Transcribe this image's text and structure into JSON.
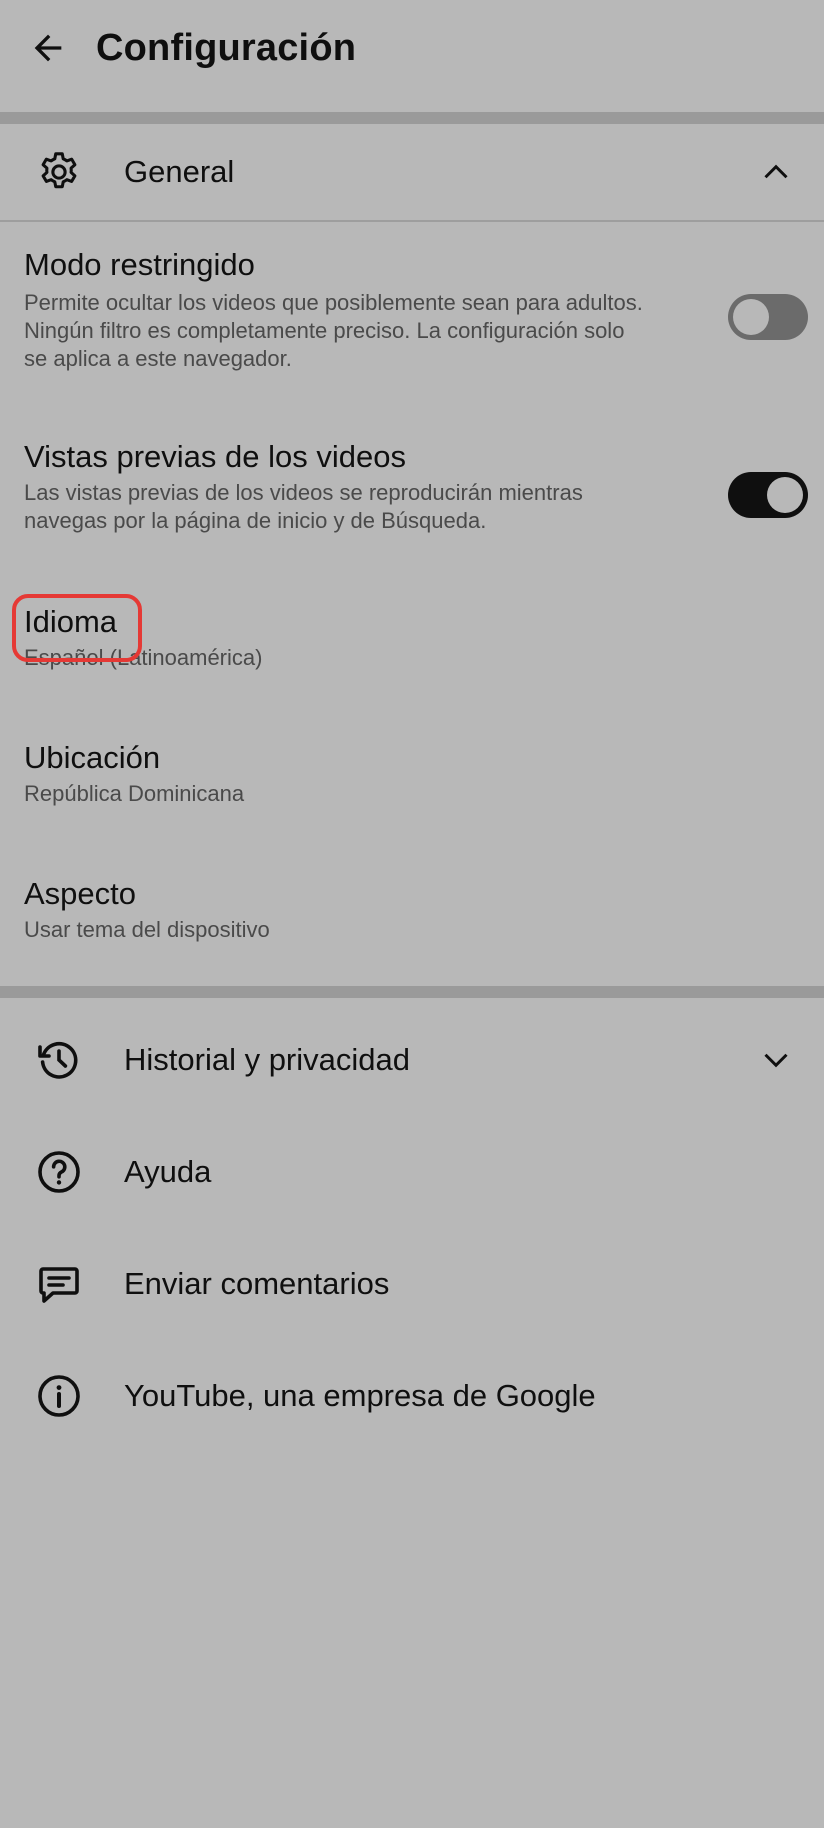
{
  "header": {
    "back_icon": "arrow-back-icon",
    "title": "Configuración"
  },
  "general": {
    "icon": "gear-icon",
    "label": "General",
    "expanded": true,
    "chevron_icon": "chevron-up-icon",
    "items": [
      {
        "title": "Modo restringido",
        "description": "Permite ocultar los videos que posiblemente sean para adultos. Ningún filtro es completamente preciso. La configuración solo se aplica a este navegador.",
        "toggle": "off"
      },
      {
        "title": "Vistas previas de los videos",
        "description": "Las vistas previas de los videos se reproducirán mientras navegas por la página de inicio y de Búsqueda.",
        "toggle": "on"
      },
      {
        "title": "Idioma",
        "value": "Español (Latinoamérica)",
        "highlighted": true
      },
      {
        "title": "Ubicación",
        "value": "República Dominicana"
      },
      {
        "title": "Aspecto",
        "value": "Usar tema del dispositivo"
      }
    ]
  },
  "menu": [
    {
      "icon": "history-icon",
      "label": "Historial y privacidad",
      "chevron_icon": "chevron-down-icon"
    },
    {
      "icon": "help-icon",
      "label": "Ayuda"
    },
    {
      "icon": "feedback-icon",
      "label": "Enviar comentarios"
    },
    {
      "icon": "info-icon",
      "label": "YouTube, una empresa de Google"
    }
  ],
  "colors": {
    "background": "#b8b8b8",
    "band": "#9a9a9a",
    "highlight": "#e53935",
    "toggle_on": "#0f0f0f",
    "toggle_off": "#6b6b6b"
  }
}
